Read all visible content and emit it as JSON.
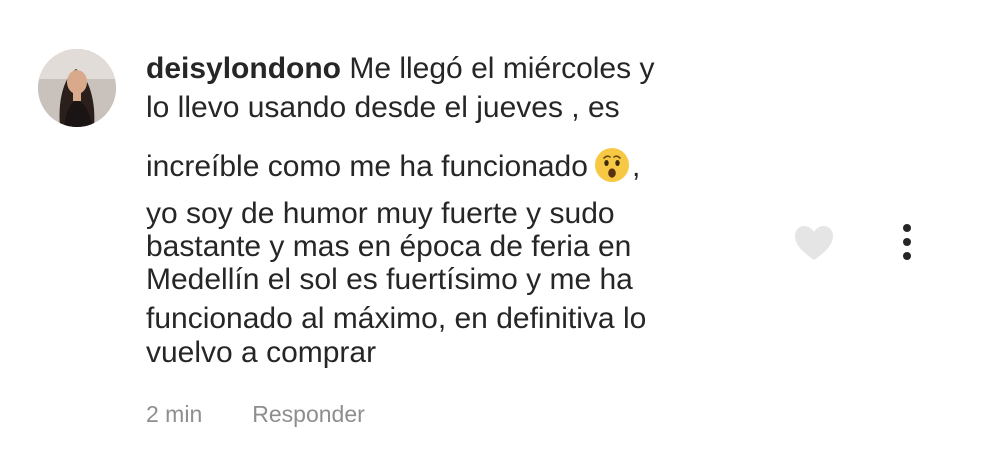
{
  "comment": {
    "username": "deisylondono",
    "lines": [
      "Me llegó el miércoles y",
      "lo llevo usando desde el jueves , es",
      "increíble como me ha funcionado",
      ",",
      "yo soy de humor muy fuerte y sudo",
      "bastante y mas en época de feria en",
      "Medellín el sol es fuertísimo y me ha",
      "funcionado al máximo, en definitiva lo",
      "vuelvo a comprar"
    ],
    "emoji_icon": "hushed-face-icon",
    "time": "2 min",
    "reply_label": "Responder"
  },
  "icons": {
    "like": "heart-outline-icon",
    "more": "more-vertical-icon"
  },
  "colors": {
    "text": "#262626",
    "meta": "#8e8e8e",
    "heart": "#e5e5e5",
    "emoji_face": "#f7c843"
  }
}
